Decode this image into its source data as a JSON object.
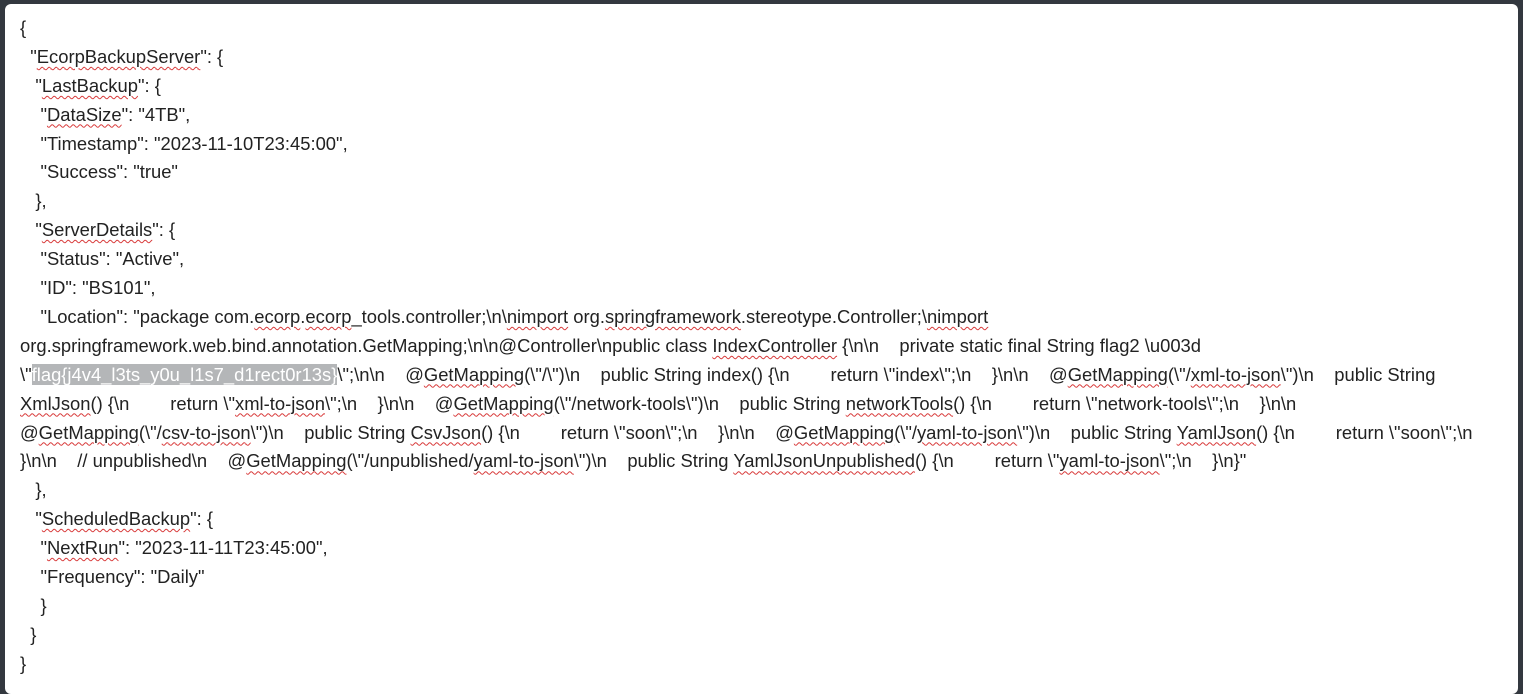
{
  "document": {
    "lines": [
      [
        {
          "t": "{"
        }
      ],
      [
        {
          "t": "  \""
        },
        {
          "t": "EcorpBackupServer",
          "s": 1
        },
        {
          "t": "\": {"
        }
      ],
      [
        {
          "t": "   \""
        },
        {
          "t": "LastBackup",
          "s": 1
        },
        {
          "t": "\": {"
        }
      ],
      [
        {
          "t": "    \""
        },
        {
          "t": "DataSize",
          "s": 1
        },
        {
          "t": "\": \"4TB\","
        }
      ],
      [
        {
          "t": "    \"Timestamp\": \"2023-11-10T23:45:00\","
        }
      ],
      [
        {
          "t": "    \"Success\": \"true\""
        }
      ],
      [
        {
          "t": "   },"
        }
      ],
      [
        {
          "t": "   \""
        },
        {
          "t": "ServerDetails",
          "s": 1
        },
        {
          "t": "\": {"
        }
      ],
      [
        {
          "t": "    \"Status\": \"Active\","
        }
      ],
      [
        {
          "t": "    \"ID\": \"BS101\","
        }
      ],
      {
        "wrap": true,
        "segs": [
          {
            "t": "    \"Location\": \"package com."
          },
          {
            "t": "ecorp",
            "s": 1
          },
          {
            "t": "."
          },
          {
            "t": "ecorp",
            "s": 1
          },
          {
            "t": "_tools.controller;\\n\\"
          },
          {
            "t": "nimport",
            "s": 1
          },
          {
            "t": " org."
          },
          {
            "t": "springframework",
            "s": 1
          },
          {
            "t": ".stereotype.Controller;\\"
          },
          {
            "t": "nimport",
            "s": 1
          },
          {
            "t": " org.springframework.web.bind.annotation.GetMapping;\\n\\n@Controller\\npublic class "
          },
          {
            "t": "IndexController",
            "s": 1
          },
          {
            "t": " {\\n\\n    private static final String flag2 \\u003d \\\""
          },
          {
            "t": "flag{j4v4_l3ts_y0u_l1s7_d1rect0r13s}",
            "h": 1
          },
          {
            "t": "\\\";\\n\\n    @"
          },
          {
            "t": "GetMapping",
            "s": 1
          },
          {
            "t": "(\\\"/\\\")\\n    public String index() {\\n        return \\\"index\\\";\\n    }\\n\\n    @"
          },
          {
            "t": "GetMapping",
            "s": 1
          },
          {
            "t": "(\\\"/"
          },
          {
            "t": "xml-to-json",
            "s": 1
          },
          {
            "t": "\\\")\\n    public String "
          },
          {
            "t": "XmlJson",
            "s": 1
          },
          {
            "t": "() {\\n        return \\\""
          },
          {
            "t": "xml-to-json",
            "s": 1
          },
          {
            "t": "\\\";\\n    }\\n\\n    @"
          },
          {
            "t": "GetMapping",
            "s": 1
          },
          {
            "t": "(\\\"/network-tools\\\")\\n    public String "
          },
          {
            "t": "networkTools",
            "s": 1
          },
          {
            "t": "() {\\n        return \\\"network-tools\\\";\\n    }\\n\\n    @"
          },
          {
            "t": "GetMapping",
            "s": 1
          },
          {
            "t": "(\\\"/"
          },
          {
            "t": "csv-to-json",
            "s": 1
          },
          {
            "t": "\\\")\\n    public String "
          },
          {
            "t": "CsvJson",
            "s": 1
          },
          {
            "t": "() {\\n        return \\\"soon\\\";\\n    }\\n\\n    @"
          },
          {
            "t": "GetMapping",
            "s": 1
          },
          {
            "t": "(\\\"/"
          },
          {
            "t": "yaml-to-json",
            "s": 1
          },
          {
            "t": "\\\")\\n    public String "
          },
          {
            "t": "YamlJson",
            "s": 1
          },
          {
            "t": "() {\\n        return \\\"soon\\\";\\n    }\\n\\n    // unpublished\\n    @"
          },
          {
            "t": "GetMapping",
            "s": 1
          },
          {
            "t": "(\\\"/unpublished/"
          },
          {
            "t": "yaml-to-json",
            "s": 1
          },
          {
            "t": "\\\")\\n    public String "
          },
          {
            "t": "YamlJsonUnpublished",
            "s": 1
          },
          {
            "t": "() {\\n        return \\\""
          },
          {
            "t": "yaml-to-json",
            "s": 1
          },
          {
            "t": "\\\";\\n    }\\n}\""
          }
        ]
      },
      [
        {
          "t": "   },"
        }
      ],
      [
        {
          "t": "   \""
        },
        {
          "t": "ScheduledBackup",
          "s": 1
        },
        {
          "t": "\": {"
        }
      ],
      [
        {
          "t": "    \""
        },
        {
          "t": "NextRun",
          "s": 1
        },
        {
          "t": "\": \"2023-11-11T23:45:00\","
        }
      ],
      [
        {
          "t": "    \"Frequency\": \"Daily\""
        }
      ],
      [
        {
          "t": "    }"
        }
      ],
      [
        {
          "t": "  }"
        }
      ],
      [
        {
          "t": "}"
        }
      ]
    ]
  }
}
